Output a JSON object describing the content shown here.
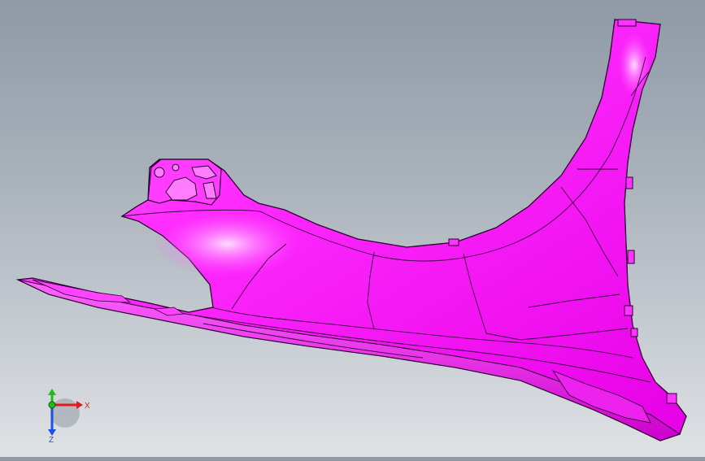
{
  "viewport": {
    "background_top": "#8f9aa6",
    "background_bottom": "#dfe2e5",
    "part_color": "#ff1aff",
    "part_edge_color": "#2a0030"
  },
  "triad": {
    "x_label": "X",
    "y_label": "Y",
    "z_label": "Z",
    "x_color": "#e01b1b",
    "y_color": "#1bbf1b",
    "z_color": "#2050e0"
  }
}
